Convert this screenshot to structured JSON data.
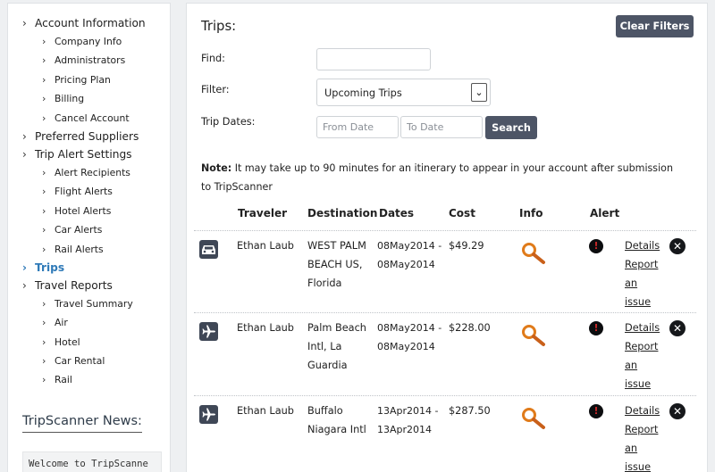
{
  "sidebar": {
    "items": [
      {
        "label": "Account Information",
        "level": 0,
        "active": false
      },
      {
        "label": "Company Info",
        "level": 1,
        "active": false
      },
      {
        "label": "Administrators",
        "level": 1,
        "active": false
      },
      {
        "label": "Pricing Plan",
        "level": 1,
        "active": false
      },
      {
        "label": "Billing",
        "level": 1,
        "active": false
      },
      {
        "label": "Cancel Account",
        "level": 1,
        "active": false
      },
      {
        "label": "Preferred Suppliers",
        "level": 0,
        "active": false
      },
      {
        "label": "Trip Alert Settings",
        "level": 0,
        "active": false
      },
      {
        "label": "Alert Recipients",
        "level": 1,
        "active": false
      },
      {
        "label": "Flight Alerts",
        "level": 1,
        "active": false
      },
      {
        "label": "Hotel Alerts",
        "level": 1,
        "active": false
      },
      {
        "label": "Car Alerts",
        "level": 1,
        "active": false
      },
      {
        "label": "Rail Alerts",
        "level": 1,
        "active": false
      },
      {
        "label": "Trips",
        "level": 0,
        "active": true
      },
      {
        "label": "Travel Reports",
        "level": 0,
        "active": false
      },
      {
        "label": "Travel Summary",
        "level": 1,
        "active": false
      },
      {
        "label": "Air",
        "level": 1,
        "active": false
      },
      {
        "label": "Hotel",
        "level": 1,
        "active": false
      },
      {
        "label": "Car Rental",
        "level": 1,
        "active": false
      },
      {
        "label": "Rail",
        "level": 1,
        "active": false
      }
    ],
    "news_title": "TripScanner News:",
    "news_text": "Welcome to TripScanne"
  },
  "main": {
    "title": "Trips:",
    "clear_filters_label": "Clear Filters",
    "find_label": "Find:",
    "find_value": "",
    "filter_label": "Filter:",
    "filter_value": "Upcoming Trips",
    "trip_dates_label": "Trip Dates:",
    "from_date_placeholder": "From Date",
    "to_date_placeholder": "To Date",
    "search_label": "Search",
    "note_label": "Note:",
    "note_text": " It may take up to 90 minutes for an itinerary to appear in your account after submission to TripScanner",
    "columns": [
      "Traveler",
      "Destination",
      "Dates",
      "Cost",
      "Info",
      "Alert"
    ],
    "trips": [
      {
        "type": "car-icon",
        "traveler": "Ethan Laub",
        "destination": "WEST PALM BEACH US, Florida",
        "dates": "08May2014 - 08May2014",
        "cost": "$49.29",
        "details": "Details",
        "report": "Report an issue"
      },
      {
        "type": "airplane-icon",
        "traveler": "Ethan Laub",
        "destination": "Palm Beach Intl, La Guardia",
        "dates": "08May2014 - 08May2014",
        "cost": "$228.00",
        "details": "Details",
        "report": "Report an issue"
      },
      {
        "type": "airplane-icon",
        "traveler": "Ethan Laub",
        "destination": "Buffalo Niagara Intl",
        "dates": "13Apr2014 - 13Apr2014",
        "cost": "$287.50",
        "details": "Details",
        "report": "Report an issue"
      }
    ]
  },
  "colors": {
    "button": "#4d5566",
    "active_link": "#2f7ab8",
    "alert": "#c62828",
    "info_icon": "#e07b1a"
  }
}
